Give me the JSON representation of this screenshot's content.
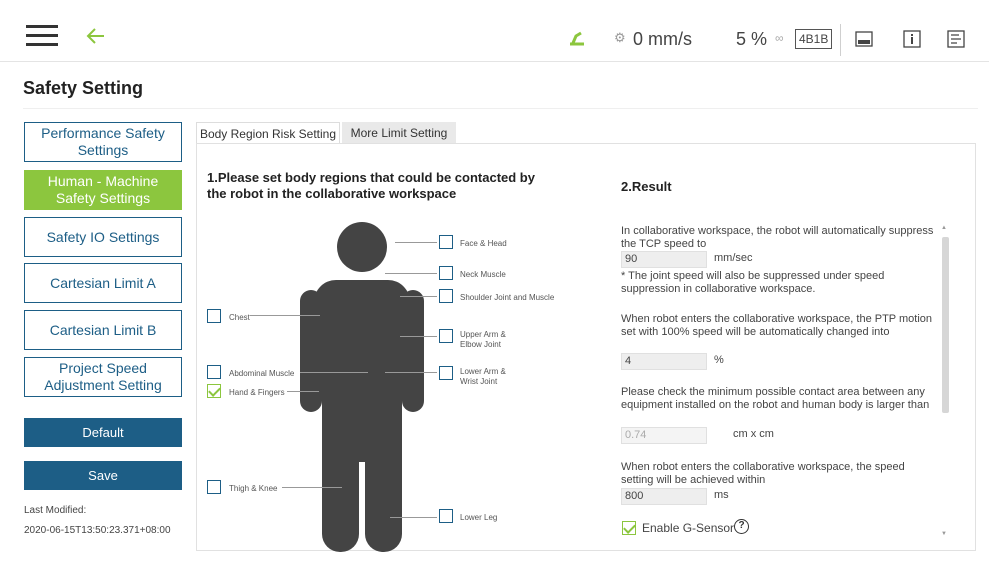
{
  "topbar": {
    "speed": "0 mm/s",
    "percent": "5 %",
    "badge": "4B1B",
    "speed_icon": "speed-icon",
    "robot_icon": "robot-status-icon"
  },
  "page": {
    "title": "Safety Setting"
  },
  "sidebar": {
    "items": [
      {
        "label": "Performance Safety Settings"
      },
      {
        "label": "Human - Machine Safety Settings"
      },
      {
        "label": "Safety IO Settings"
      },
      {
        "label": "Cartesian Limit A"
      },
      {
        "label": "Cartesian Limit B"
      },
      {
        "label": "Project Speed Adjustment Setting"
      }
    ],
    "default_label": "Default",
    "save_label": "Save",
    "last_modified_label": "Last Modified:",
    "last_modified_value": "2020-06-15T13:50:23.371+08:00"
  },
  "tabs": [
    {
      "label": "Body Region Risk Setting"
    },
    {
      "label": "More Limit Setting"
    }
  ],
  "section1": {
    "title": "1.Please set body regions that could be contacted by the robot in the collaborative workspace",
    "regions": {
      "face_head": {
        "label": "Face & Head",
        "checked": false
      },
      "neck": {
        "label": "Neck Muscle",
        "checked": false
      },
      "shoulder": {
        "label": "Shoulder Joint and Muscle",
        "checked": false
      },
      "chest": {
        "label": "Chest",
        "checked": false
      },
      "upper_arm": {
        "label": "Upper Arm & Elbow Joint",
        "checked": false
      },
      "abdominal": {
        "label": "Abdominal Muscle",
        "checked": false
      },
      "lower_arm": {
        "label": "Lower Arm & Wrist Joint",
        "checked": false
      },
      "hand": {
        "label": "Hand & Fingers",
        "checked": true
      },
      "thigh": {
        "label": "Thigh & Knee",
        "checked": false
      },
      "lower_leg": {
        "label": "Lower Leg",
        "checked": false
      }
    }
  },
  "section2": {
    "title": "2.Result",
    "tcp_text": "In collaborative workspace, the robot will automatically suppress the TCP speed to",
    "tcp_value": "90",
    "tcp_unit": "mm/sec",
    "joint_note": "* The joint speed will also be suppressed under speed suppression in collaborative workspace.",
    "ptp_text": "When robot enters the collaborative workspace, the PTP motion set with 100% speed will be automatically changed into",
    "ptp_value": "4",
    "ptp_unit": "%",
    "contact_text": "Please check the minimum possible contact area between any equipment installed on the robot and human body is larger than",
    "contact_value": "0.74",
    "contact_unit": "cm x cm",
    "time_text": "When robot enters the collaborative workspace, the speed setting will be achieved within",
    "time_value": "800",
    "time_unit": "ms",
    "gsensor_label": "Enable G-Sensor",
    "help_glyph": "?"
  },
  "colors": {
    "accent_green": "#8cc63e",
    "primary_blue": "#1d5e86"
  }
}
